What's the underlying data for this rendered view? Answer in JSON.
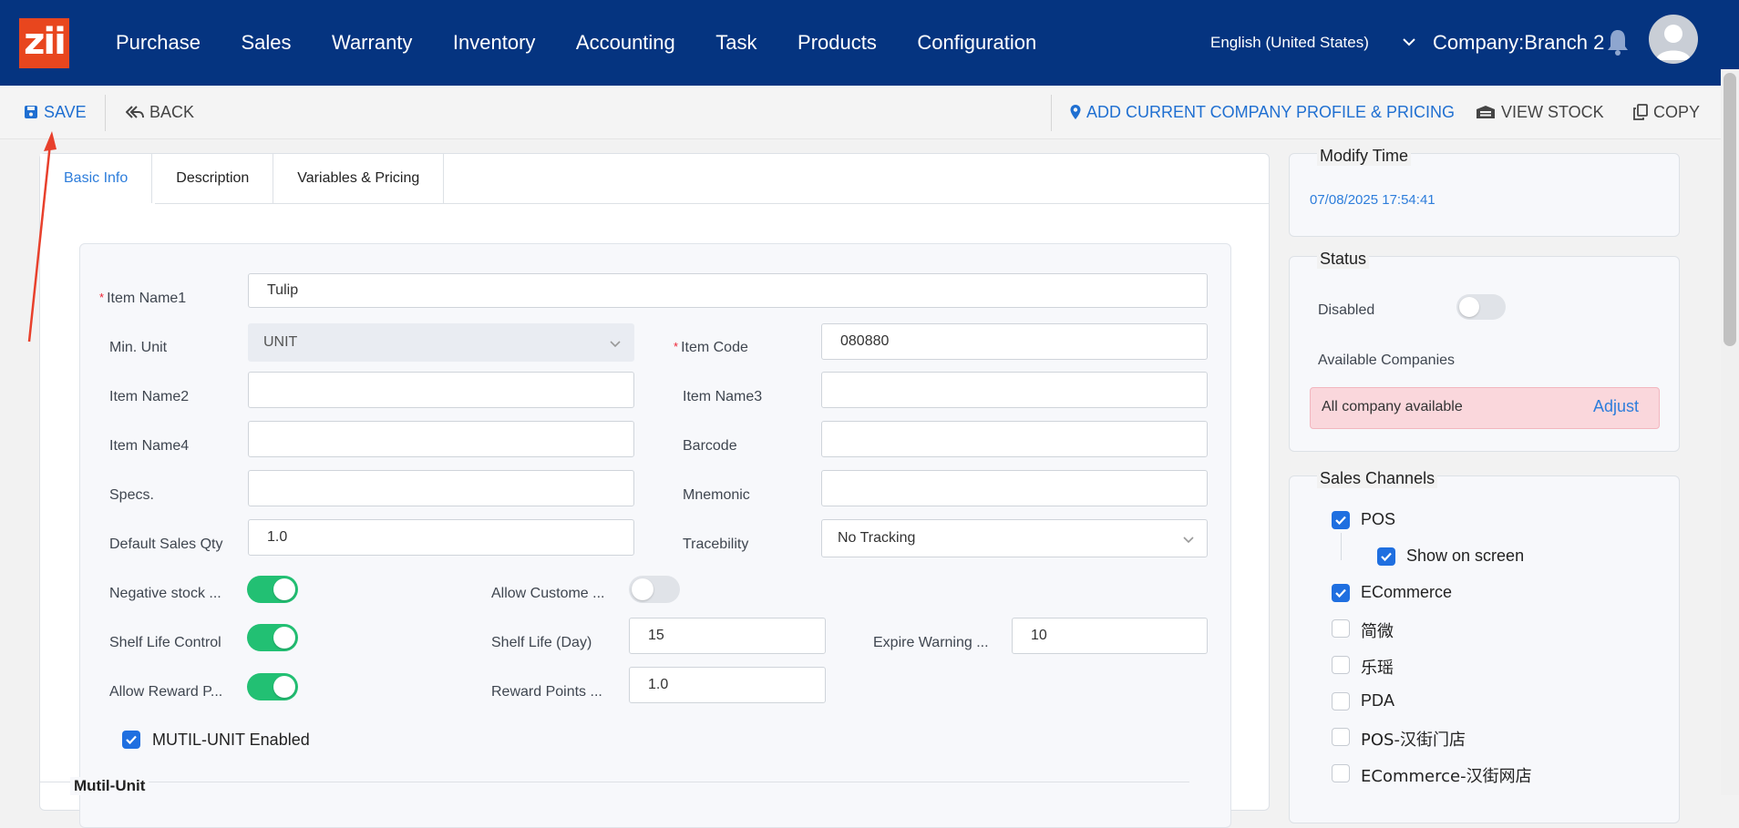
{
  "brand": {
    "logo_text": "zii",
    "logo_color": "#e8461e",
    "nav_bg": "#053480"
  },
  "nav": {
    "items": [
      "Purchase",
      "Sales",
      "Warranty",
      "Inventory",
      "Accounting",
      "Task",
      "Products",
      "Configuration"
    ],
    "language": "English (United States)",
    "company": "Company:Branch 2"
  },
  "toolbar": {
    "save": "SAVE",
    "back": "BACK",
    "add_profile": "ADD CURRENT COMPANY PROFILE & PRICING",
    "view_stock": "VIEW STOCK",
    "copy": "COPY"
  },
  "tabs": [
    "Basic Info",
    "Description",
    "Variables & Pricing"
  ],
  "form": {
    "item_name1_label": "Item Name1",
    "item_name1_value": "Tulip",
    "min_unit_label": "Min. Unit",
    "min_unit_value": "UNIT",
    "item_code_label": "Item Code",
    "item_code_value": "080880",
    "item_name2_label": "Item Name2",
    "item_name3_label": "Item Name3",
    "item_name4_label": "Item Name4",
    "barcode_label": "Barcode",
    "specs_label": "Specs.",
    "mnemonic_label": "Mnemonic",
    "default_sales_qty_label": "Default Sales Qty",
    "default_sales_qty_value": "1.0",
    "tracebility_label": "Tracebility",
    "tracebility_value": "No Tracking",
    "negative_stock_label": "Negative stock ...",
    "negative_stock_on": true,
    "allow_customer_label": "Allow Custome ...",
    "allow_customer_on": false,
    "shelf_life_control_label": "Shelf Life Control",
    "shelf_life_control_on": true,
    "shelf_life_day_label": "Shelf Life (Day)",
    "shelf_life_day_value": "15",
    "expire_warning_label": "Expire Warning ...",
    "expire_warning_value": "10",
    "allow_reward_label": "Allow Reward P...",
    "allow_reward_on": true,
    "reward_points_label": "Reward Points ...",
    "reward_points_value": "1.0",
    "multi_unit_label": "MUTIL-UNIT Enabled",
    "multi_unit_checked": true,
    "multi_unit_section": "Mutil-Unit"
  },
  "side": {
    "modify_time_title": "Modify Time",
    "modify_time_value": "07/08/2025 17:54:41",
    "status_title": "Status",
    "disabled_label": "Disabled",
    "disabled_on": false,
    "available_companies_label": "Available Companies",
    "all_company_text": "All company available",
    "adjust_link": "Adjust",
    "sales_channels_title": "Sales Channels",
    "channels": [
      {
        "label": "POS",
        "checked": true
      },
      {
        "label": "Show on screen",
        "checked": true
      },
      {
        "label": "ECommerce",
        "checked": true
      },
      {
        "label": "简微",
        "checked": false
      },
      {
        "label": "乐瑶",
        "checked": false
      },
      {
        "label": "PDA",
        "checked": false
      },
      {
        "label": "POS-汉街门店",
        "checked": false
      },
      {
        "label": "ECommerce-汉街网店",
        "checked": false
      }
    ]
  }
}
